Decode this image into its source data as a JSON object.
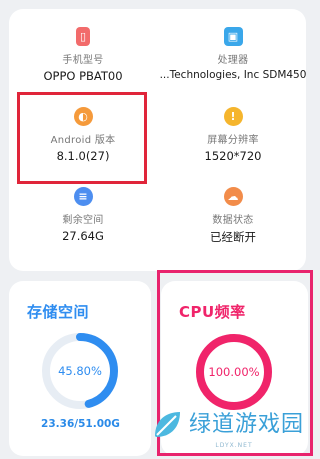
{
  "info": {
    "model": {
      "label": "手机型号",
      "value": "OPPO PBAT00",
      "icon": "phone-icon",
      "color": "#f26b6b"
    },
    "processor": {
      "label": "处理器",
      "value": "...Technologies, Inc SDM450",
      "icon": "chip-icon",
      "color": "#3aa7ea"
    },
    "android": {
      "label": "Android 版本",
      "value": "8.1.0(27)",
      "icon": "android-icon",
      "color": "#f59a3b"
    },
    "resolution": {
      "label": "屏幕分辨率",
      "value": "1520*720",
      "icon": "display-icon",
      "color": "#f5b52d"
    },
    "storage_free": {
      "label": "剩余空间",
      "value": "27.64G",
      "icon": "sliders-icon",
      "color": "#4d8ef0"
    },
    "data_status": {
      "label": "数据状态",
      "value": "已经断开",
      "icon": "cloud-icon",
      "color": "#f28c4a"
    }
  },
  "storage": {
    "title": "存储空间",
    "percent_text": "45.80%",
    "percent": 45.8,
    "used": "23.36/51.00G",
    "color": "#2f8df0"
  },
  "cpu": {
    "title": "CPU频率",
    "percent_text": "100.00%",
    "percent": 100,
    "color": "#f0246a"
  },
  "watermark": {
    "text": "绿道游戏园",
    "sub": "LDYX.NET"
  }
}
